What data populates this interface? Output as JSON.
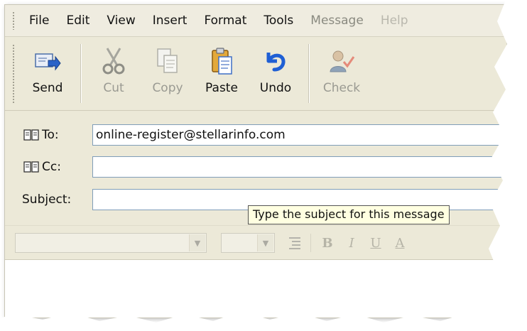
{
  "menu": {
    "items": [
      "File",
      "Edit",
      "View",
      "Insert",
      "Format",
      "Tools",
      "Message",
      "Help"
    ]
  },
  "toolbar": {
    "send": "Send",
    "cut": "Cut",
    "copy": "Copy",
    "paste": "Paste",
    "undo": "Undo",
    "check": "Check"
  },
  "fields": {
    "to_label": "To:",
    "to_value": "online-register@stellarinfo.com",
    "cc_label": "Cc:",
    "cc_value": "",
    "subject_label": "Subject:",
    "subject_value": ""
  },
  "tooltip": "Type the subject for this message",
  "format": {
    "bold": "B",
    "italic": "I",
    "underline": "U",
    "font_color": "A"
  },
  "icons": {
    "send": "send-icon",
    "cut": "scissors-icon",
    "copy": "copy-icon",
    "paste": "clipboard-icon",
    "undo": "undo-icon",
    "check": "check-names-icon",
    "address_book": "address-book-icon",
    "list": "list-icon"
  },
  "colors": {
    "window_bg": "#ece9d8",
    "input_border": "#7f9db9",
    "tooltip_bg": "#ffffe1",
    "undo_blue": "#1f5fd4"
  }
}
